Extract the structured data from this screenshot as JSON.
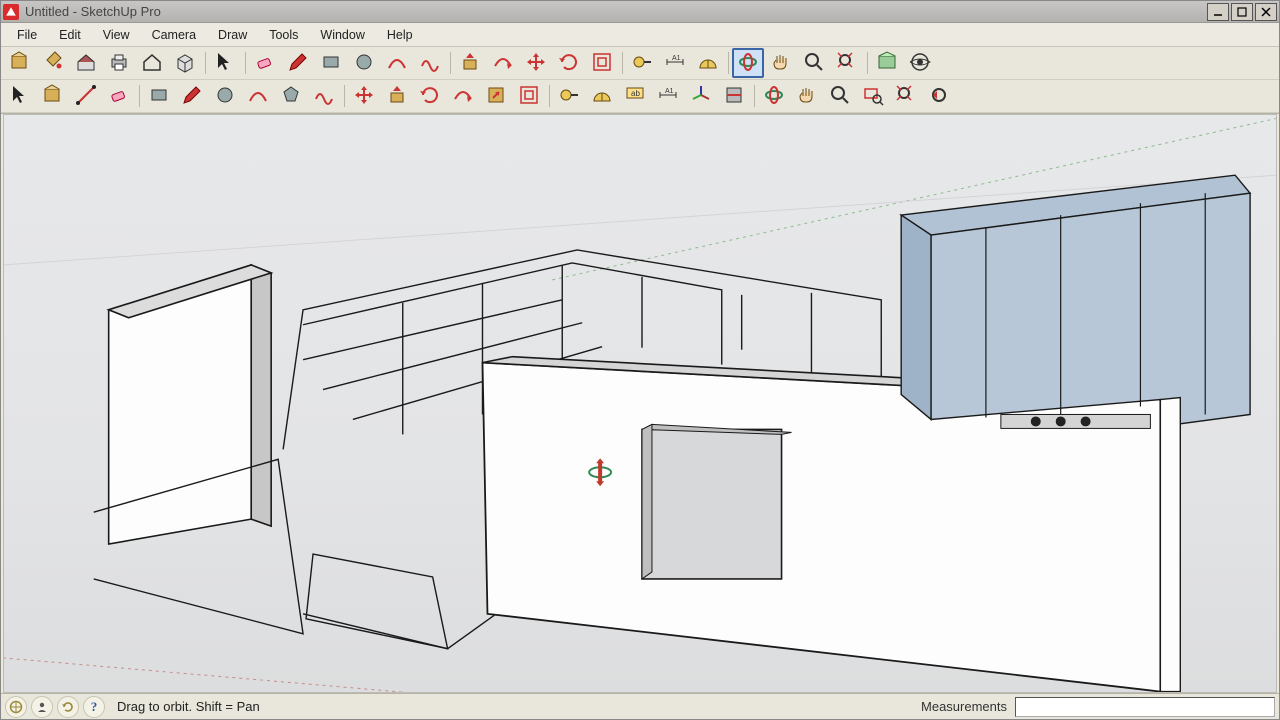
{
  "window": {
    "title": "Untitled - SketchUp Pro",
    "buttons": {
      "minimize": "_",
      "maximize": "▢",
      "close": "✕"
    }
  },
  "menu": {
    "file": "File",
    "edit": "Edit",
    "view": "View",
    "camera": "Camera",
    "draw": "Draw",
    "tools": "Tools",
    "window": "Window",
    "help": "Help"
  },
  "toolbar_row1": [
    "make-component",
    "paint-bucket",
    "house-model",
    "print",
    "house-outline",
    "box",
    "select-arrow",
    "eraser",
    "pencil",
    "rectangle",
    "circle",
    "arc",
    "freehand",
    "push-pull",
    "follow-me",
    "move",
    "rotate",
    "offset",
    "tape-measure",
    "dimension",
    "protractor",
    "orbit",
    "pan",
    "zoom",
    "zoom-extents",
    "get-models",
    "look-around"
  ],
  "toolbar_row2": [
    "select-arrow-2",
    "make-component-2",
    "line-tool",
    "eraser-2",
    "rectangle-2",
    "pencil-2",
    "circle-2",
    "arc-2",
    "polygon",
    "freehand-2",
    "move-2",
    "push-pull-2",
    "rotate-2",
    "follow-me-2",
    "scale",
    "offset-2",
    "tape-measure-2",
    "protractor-2",
    "text-tool",
    "dimension-2",
    "axes",
    "section-plane",
    "orbit-2",
    "pan-2",
    "zoom-2",
    "zoom-window",
    "zoom-extents-2",
    "previous-view"
  ],
  "active_tool": "orbit",
  "status": {
    "hint": "Drag to orbit.  Shift = Pan",
    "measurements_label": "Measurements",
    "measurements_value": ""
  },
  "viewport": {
    "cursor": "orbit-cursor",
    "model": "architectural-walls-3d"
  }
}
